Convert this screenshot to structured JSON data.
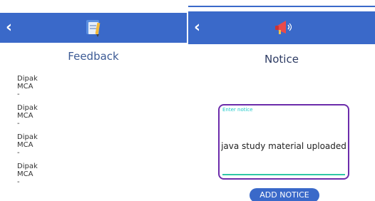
{
  "colors": {
    "appbar": "#3a69c9",
    "title_left": "#3c5a95",
    "title_right": "#2d3b63",
    "box_border": "#6c2cab",
    "label": "#1fc8c8",
    "underline": "#2fc7a6",
    "button": "#3a69c9",
    "top_line": "#3a69c9"
  },
  "feedback_screen": {
    "back_icon": "chevron-left-icon",
    "app_icon": "feedback-notepad-icon",
    "title": "Feedback",
    "items": [
      {
        "name": "Dipak",
        "course": "MCA",
        "message": "-"
      },
      {
        "name": "Dipak",
        "course": "MCA",
        "message": "-"
      },
      {
        "name": "Dipak",
        "course": "MCA",
        "message": "-"
      },
      {
        "name": "Dipak",
        "course": "MCA",
        "message": "-"
      }
    ]
  },
  "notice_screen": {
    "back_icon": "chevron-left-icon",
    "app_icon": "megaphone-icon",
    "title": "Notice",
    "field_label": "Enter notice",
    "field_value": "java study material uploaded",
    "button_label": "ADD NOTICE"
  }
}
